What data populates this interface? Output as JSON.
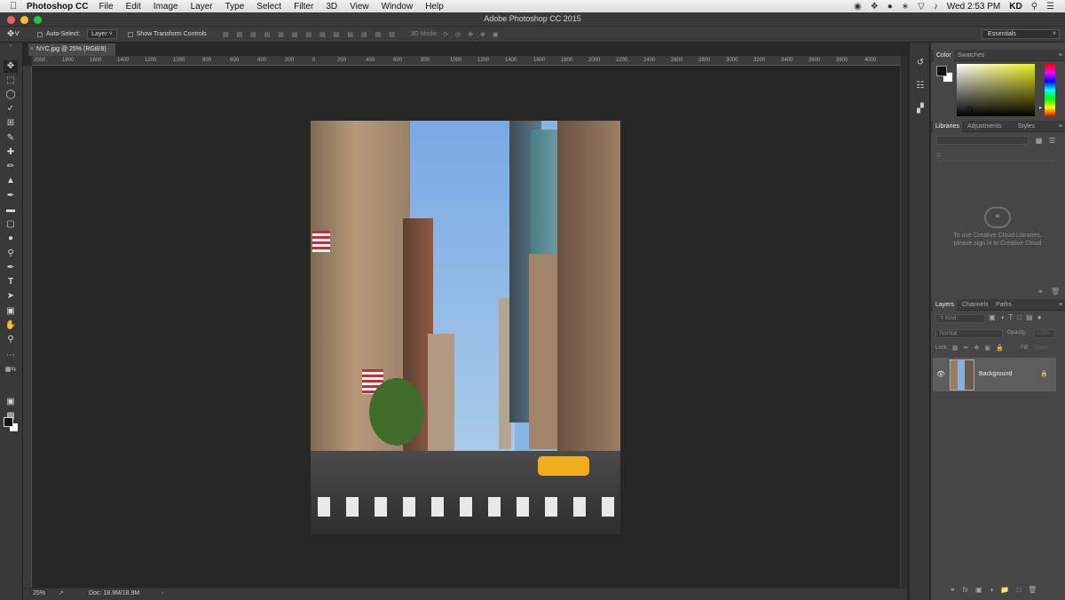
{
  "menubar": {
    "apple": "",
    "app_name": "Photoshop CC",
    "items": [
      "File",
      "Edit",
      "Image",
      "Layer",
      "Type",
      "Select",
      "Filter",
      "3D",
      "View",
      "Window",
      "Help"
    ],
    "clock": "Wed 2:53 PM",
    "user": "KD"
  },
  "window": {
    "title": "Adobe Photoshop CC 2015"
  },
  "options": {
    "auto_select_label": "Auto-Select:",
    "auto_select_target": "Layer",
    "show_transform_label": "Show Transform Controls",
    "mode_3d_label": "3D Mode:",
    "workspace": "Essentials"
  },
  "document": {
    "tab_label": "NYC.jpg @ 25% (RGB/8)",
    "close": "×"
  },
  "ruler": {
    "h_ticks": [
      "2000",
      "1800",
      "1600",
      "1400",
      "1200",
      "1000",
      "800",
      "600",
      "400",
      "200",
      "0",
      "200",
      "400",
      "600",
      "800",
      "1000",
      "1200",
      "1400",
      "1600",
      "1800",
      "2000",
      "2200",
      "2400",
      "2600",
      "2800",
      "3000",
      "3200",
      "3400",
      "3600",
      "3800",
      "4000"
    ]
  },
  "status": {
    "zoom": "25%",
    "doc_info": "Doc: 18.9M/18.9M"
  },
  "color_panel": {
    "tabs": [
      "Color",
      "Swatches"
    ],
    "foreground": "#111111",
    "background": "#ffffff"
  },
  "libraries_panel": {
    "tabs": [
      "Libraries",
      "Adjustments",
      "Styles"
    ],
    "search_placeholder": "",
    "message_line1": "To use Creative Cloud Libraries,",
    "message_line2": "please sign in to Creative Cloud"
  },
  "layers_panel": {
    "tabs": [
      "Layers",
      "Channels",
      "Paths"
    ],
    "filter_kind": "Kind",
    "blend_mode": "Normal",
    "opacity_label": "Opacity:",
    "opacity_value": "100%",
    "lock_label": "Lock:",
    "fill_label": "Fill:",
    "fill_value": "100%",
    "layers": [
      {
        "name": "Background",
        "visible": true,
        "locked": true
      }
    ]
  }
}
